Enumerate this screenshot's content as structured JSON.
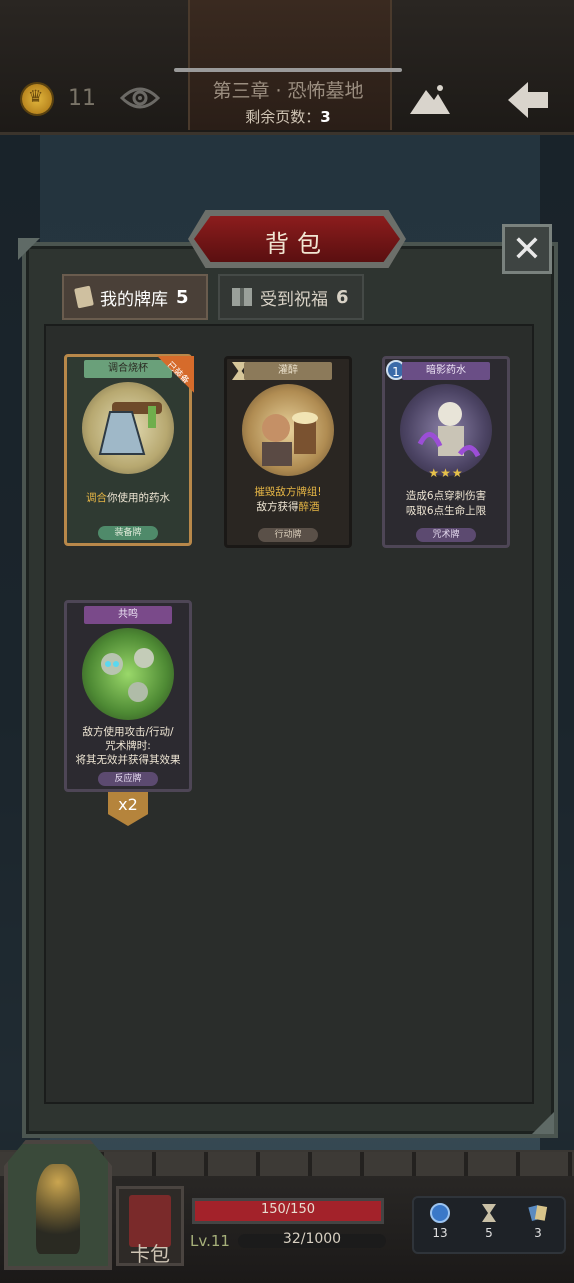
{
  "header": {
    "coins": "11",
    "chapter": "第三章 · 恐怖墓地",
    "remaining_label": "剩余页数：",
    "remaining_pages": "3",
    "icons": [
      "crown-coin-icon",
      "eye-icon",
      "mountain-icon",
      "back-arrow-icon"
    ]
  },
  "bag": {
    "title": "背包",
    "close_label": "✕",
    "tabs": [
      {
        "label": "我的牌库",
        "count": "5"
      },
      {
        "label": "受到祝福",
        "count": "6"
      }
    ]
  },
  "cards": [
    {
      "name": "调合烧杯",
      "desc_hl": "调合",
      "desc": "你使用的药水",
      "type": "装备牌",
      "badge": "已装备"
    },
    {
      "name": "灌醉",
      "desc_line1": "摧毁敌方牌组!",
      "desc_line2_pre": "敌方获得",
      "desc_line2_hl": "醉酒",
      "type": "行动牌"
    },
    {
      "name": "暗影药水",
      "number": "1",
      "stars": "★★★",
      "desc_line1": "造成6点穿刺伤害",
      "desc_line2": "吸取6点生命上限",
      "type": "咒术牌"
    },
    {
      "name": "共鸣",
      "desc_line1": "敌方使用攻击/行动/",
      "desc_line2": "咒术牌时:",
      "desc_line3": "将其无效并获得其效果",
      "type": "反应牌",
      "multiplier": "x2"
    }
  ],
  "footer": {
    "deck_label": "卡包",
    "hp": "150/150",
    "hp_fraction": 1.0,
    "level": "Lv.11",
    "xp": "32/1000",
    "stats": [
      {
        "icon": "orb-icon",
        "value": "13"
      },
      {
        "icon": "hourglass-icon",
        "value": "5"
      },
      {
        "icon": "cards-icon",
        "value": "3"
      }
    ]
  }
}
